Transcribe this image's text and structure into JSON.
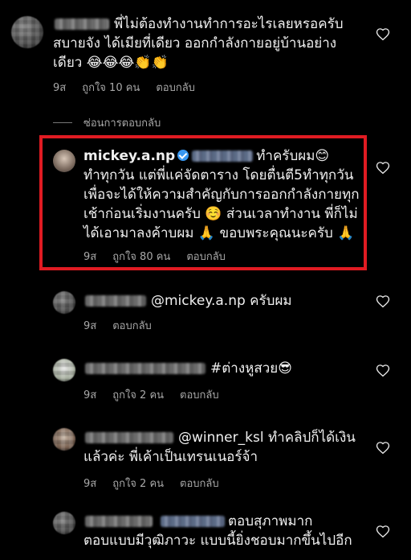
{
  "comments": [
    {
      "id": "c1",
      "text": "พี่ไม่ต้องทำงานทำการอะไรเลยหรอครับ สบายจัง ได้เมียที่เดียว ออกกำลังกายอยู่บ้านอย่าง เดียว 😂😂😂👏👏",
      "line1": "พี่ไม่ต้องทำงานทำการอะไรเลยหรอครับ",
      "line2": "สบายจัง ได้เมียที่เดียว ออกกำลังกายอยู่บ้านอย่าง",
      "line3": "เดียว 😂😂😂👏👏",
      "time": "9ส",
      "likes": "ถูกใจ 10 คน",
      "reply": "ตอบกลับ"
    },
    {
      "id": "c2",
      "username": "mickey.a.np",
      "line1_suffix": "ทำครับผม😊",
      "line2": "ทำทุกวัน แต่พี่แค่จัดตาราง โดยตื่นตี5ทำทุกวัน",
      "line3": "เพื่อจะได้ให้ความสำคัญกับการออกกำลังกายทุก",
      "line4": "เช้าก่อนเริ่มงานครับ ☺️ ส่วนเวลาทำงาน พี่ก็ไม่",
      "line5": "ได้เอามาลงค้าบผม 🙏 ขอบพระคุณนะครับ 🙏",
      "time": "9ส",
      "likes": "ถูกใจ 80 คน",
      "reply": "ตอบกลับ"
    },
    {
      "id": "c3",
      "text": "@mickey.a.np ครับผม",
      "time": "9ส",
      "reply": "ตอบกลับ"
    },
    {
      "id": "c4",
      "text": "#ต่างหูสวย😎",
      "time": "9ส",
      "likes": "ถูกใจ 2 คน",
      "reply": "ตอบกลับ"
    },
    {
      "id": "c5",
      "line1": "@winner_ksl ทำคลิปก็ได้เงิน",
      "line2": "แล้วค่ะ พี่เค้าเป็นเทรนเนอร์จ้า",
      "time": "9ส",
      "likes": "ถูกใจ 2 คน",
      "reply": "ตอบกลับ"
    },
    {
      "id": "c6",
      "line1": "ตอบสุภาพมาก",
      "line2": "ตอบแบบมีวุฒิภาวะ แบบนี้ยิ่งชอบมากขึ้นไปอีก"
    }
  ],
  "hide_replies": "ซ่อนการตอบกลับ",
  "icons": {
    "like": "heart-outline-icon",
    "verified": "verified-badge-icon"
  },
  "colors": {
    "highlight": "#e01b22",
    "verified": "#3897f0",
    "meta": "#a8a8a8"
  }
}
